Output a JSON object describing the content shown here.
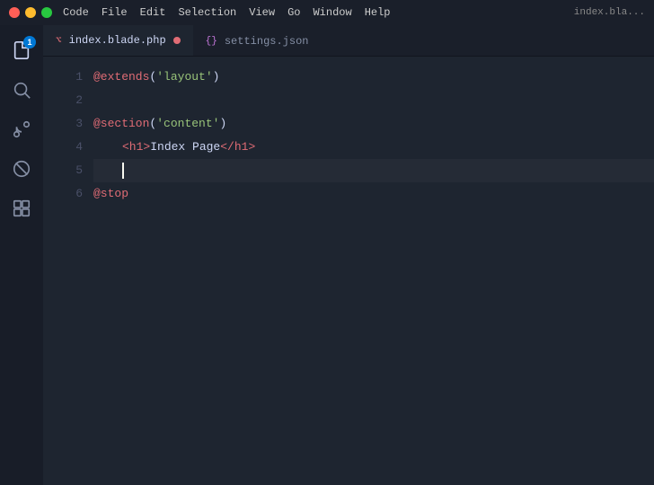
{
  "titlebar": {
    "app_name": "Code",
    "menus": [
      "File",
      "Edit",
      "Selection",
      "View",
      "Go",
      "Window",
      "Help"
    ],
    "window_title": "index.bla..."
  },
  "activity_bar": {
    "items": [
      {
        "id": "files",
        "label": "Files",
        "badge": "1"
      },
      {
        "id": "search",
        "label": "Search"
      },
      {
        "id": "source-control",
        "label": "Source Control"
      },
      {
        "id": "extensions",
        "label": "Extensions"
      },
      {
        "id": "remote",
        "label": "Remote Explorer"
      }
    ]
  },
  "tabs": [
    {
      "id": "blade",
      "filename": "index.blade.php",
      "active": true,
      "dirty": true,
      "icon_type": "blade"
    },
    {
      "id": "json",
      "filename": "settings.json",
      "active": false,
      "icon_type": "json"
    }
  ],
  "code": {
    "lines": [
      {
        "num": 1,
        "content": "@extends('layout')"
      },
      {
        "num": 2,
        "content": ""
      },
      {
        "num": 3,
        "content": "@section('content')"
      },
      {
        "num": 4,
        "content": "    <h1>Index Page</h1>"
      },
      {
        "num": 5,
        "content": ""
      },
      {
        "num": 6,
        "content": "@stop"
      }
    ]
  },
  "colors": {
    "blade_at": "#e06c75",
    "string": "#98c379",
    "html_tag": "#e06c75",
    "html_text": "#cdd6f4",
    "cursor": "#f8f8f0",
    "active_line_bg": "rgba(255,255,255,0.04)"
  }
}
